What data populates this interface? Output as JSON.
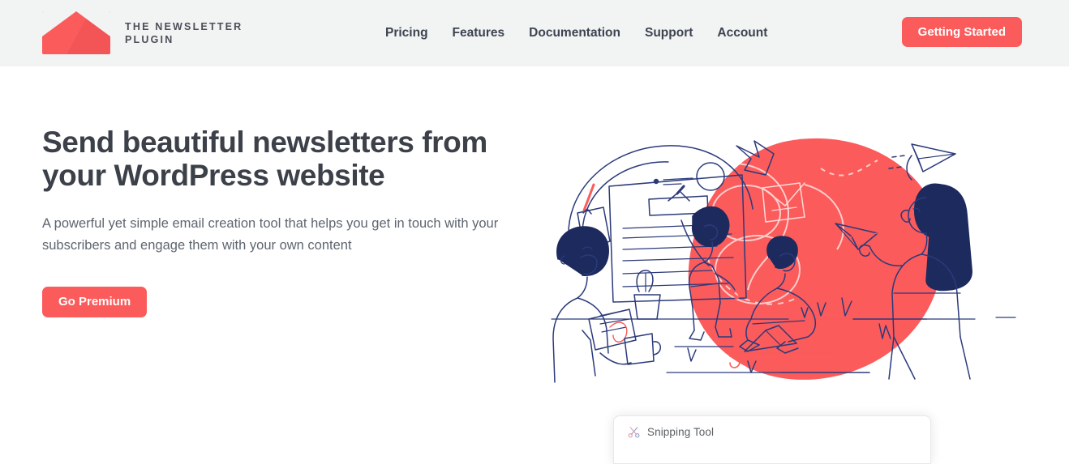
{
  "header": {
    "brand": {
      "logo_icon": "envelope-icon",
      "line1": "THE NEWSLETTER",
      "line2": "PLUGIN"
    },
    "nav": [
      {
        "label": "Pricing"
      },
      {
        "label": "Features"
      },
      {
        "label": "Documentation"
      },
      {
        "label": "Support"
      },
      {
        "label": "Account"
      }
    ],
    "cta_label": "Getting Started",
    "background": "#f2f3f3"
  },
  "hero": {
    "title": "Send beautiful newsletters from your WordPress website",
    "subtitle": "A powerful yet simple email creation tool that helps you get in touch with your subscribers and engage them with your own content",
    "cta_label": "Go Premium",
    "illustration": {
      "name": "newsletter-team-illustration",
      "blob_color": "#fb5b5b",
      "line_color": "#2b3a7a"
    }
  },
  "snipping_tool": {
    "title": "Snipping Tool",
    "icon": "scissors-icon"
  },
  "colors": {
    "accent": "#fb5b5b",
    "heading": "#3c4049",
    "body_text": "#5e656f",
    "nav_text": "#3d4451",
    "header_bg": "#f2f3f3",
    "page_bg": "#ffffff"
  }
}
